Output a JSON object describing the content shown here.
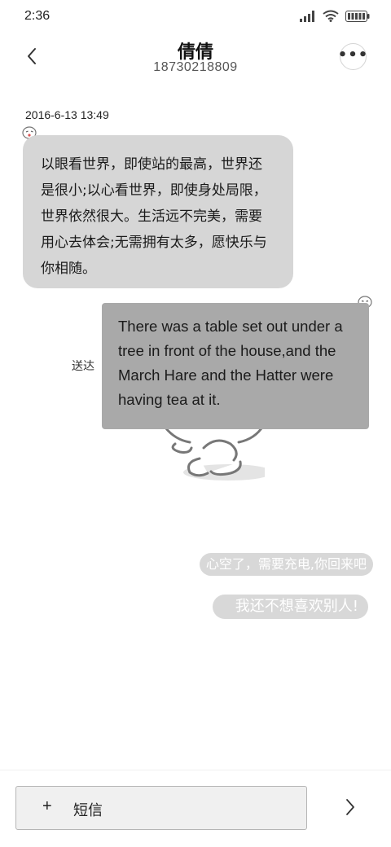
{
  "status_bar": {
    "time": "2:36",
    "icons": [
      "signal-icon",
      "wifi-icon",
      "battery-icon"
    ]
  },
  "header": {
    "contact_name": "倩倩",
    "contact_number": "18730218809",
    "back_icon": "chevron-left-icon",
    "more_icon": "more-horizontal-icon"
  },
  "conversation": {
    "timestamp": "2016-6-13 13:49",
    "incoming_message": {
      "text": "以眼看世界，即使站的最高，世界还是很小;以心看世界，即使身处局限，世界依然很大。生活远不完美，需要用心去体会;无需拥有太多，愿快乐与你相随。"
    },
    "outgoing_message": {
      "text": "There was a table set out under a tree in front of the house,and the March Hare and the Hatter were having tea at it.",
      "status": "送达"
    },
    "quick_replies": [
      "心空了，需要充电,你回来吧",
      "我还不想喜欢别人!"
    ]
  },
  "composer": {
    "add_icon": "+",
    "placeholder": "短信",
    "send_icon": "chevron-right-icon"
  },
  "colors": {
    "incoming_bubble": "#d6d6d6",
    "outgoing_bubble": "#a9a9a9",
    "quick_reply_pill": "#d8d8d8",
    "composer_bg": "#f0f0f0"
  }
}
